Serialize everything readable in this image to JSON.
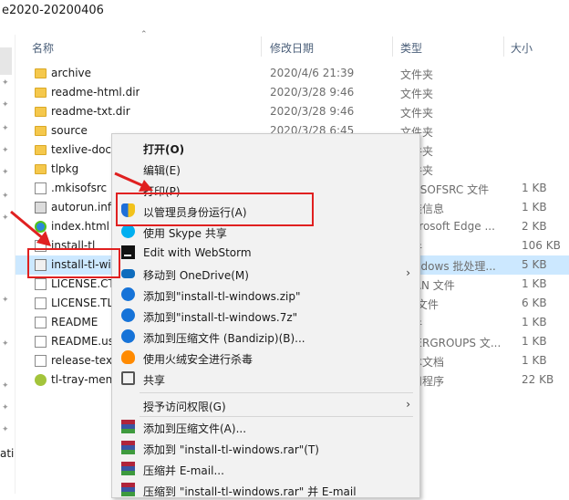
{
  "window": {
    "title": "e2020-20200406"
  },
  "nav": {
    "text": "ati"
  },
  "columns": {
    "name": "名称",
    "date": "修改日期",
    "type": "类型",
    "size": "大小"
  },
  "files": [
    {
      "name": "archive",
      "date": "2020/4/6 21:39",
      "type": "文件夹",
      "size": "",
      "icon": "folder-icon"
    },
    {
      "name": "readme-html.dir",
      "date": "2020/3/28 9:46",
      "type": "文件夹",
      "size": "",
      "icon": "folder-icon"
    },
    {
      "name": "readme-txt.dir",
      "date": "2020/3/28 9:46",
      "type": "文件夹",
      "size": "",
      "icon": "folder-icon"
    },
    {
      "name": "source",
      "date": "2020/3/28 6:45",
      "type": "文件夹",
      "size": "",
      "icon": "folder-icon"
    },
    {
      "name": "texlive-doc",
      "date": "",
      "type": "文件夹",
      "size": "",
      "icon": "folder-icon"
    },
    {
      "name": "tlpkg",
      "date": "",
      "type": "文件夹",
      "size": "",
      "icon": "folder-icon"
    },
    {
      "name": ".mkisofsrc",
      "date": "",
      "type": "MKISOFSRC 文件",
      "size": "1 KB",
      "icon": "file-icon"
    },
    {
      "name": "autorun.inf",
      "date": "",
      "type": "安装信息",
      "size": "1 KB",
      "icon": "gear-file-icon"
    },
    {
      "name": "index.html",
      "date": "",
      "type": "Microsoft Edge ...",
      "size": "2 KB",
      "icon": "edge-icon"
    },
    {
      "name": "install-tl",
      "date": "",
      "type": "文件",
      "size": "106 KB",
      "icon": "file-icon"
    },
    {
      "name": "install-tl-windows.bat",
      "date": "",
      "type": "Windows 批处理...",
      "size": "5 KB",
      "icon": "batch-file-icon"
    },
    {
      "name": "LICENSE.CTAN",
      "date": "",
      "type": "CTAN 文件",
      "size": "1 KB",
      "icon": "file-icon"
    },
    {
      "name": "LICENSE.TL",
      "date": "",
      "type": "TL 文件",
      "size": "6 KB",
      "icon": "file-icon"
    },
    {
      "name": "README",
      "date": "",
      "type": "文件",
      "size": "1 KB",
      "icon": "file-icon"
    },
    {
      "name": "README.usergroups",
      "date": "",
      "type": "USERGROUPS 文...",
      "size": "1 KB",
      "icon": "file-icon"
    },
    {
      "name": "release-texlive.txt",
      "date": "",
      "type": "文本文档",
      "size": "1 KB",
      "icon": "file-icon"
    },
    {
      "name": "tl-tray-menu.exe",
      "date": "",
      "type": "应用程序",
      "size": "22 KB",
      "icon": "tray-app-icon"
    }
  ],
  "context_menu": {
    "items": [
      {
        "label": "打开(O)",
        "icon": "",
        "bold": true
      },
      {
        "label": "编辑(E)",
        "icon": ""
      },
      {
        "label": "打印(P)",
        "icon": ""
      },
      {
        "label": "以管理员身份运行(A)",
        "icon": "shield-icon"
      },
      {
        "label": "使用 Skype 共享",
        "icon": "skype-icon"
      },
      {
        "label": "Edit with WebStorm",
        "icon": "webstorm-icon"
      },
      {
        "label": "移动到 OneDrive(M)",
        "icon": "onedrive-icon",
        "submenu": true
      },
      {
        "label": "添加到\"install-tl-windows.zip\"",
        "icon": "bandizip-icon"
      },
      {
        "label": "添加到\"install-tl-windows.7z\"",
        "icon": "bandizip-icon"
      },
      {
        "label": "添加到压缩文件 (Bandizip)(B)...",
        "icon": "bandizip-icon"
      },
      {
        "label": "使用火绒安全进行杀毒",
        "icon": "huorong-icon"
      },
      {
        "label": "共享",
        "icon": "share-icon"
      },
      {
        "label": "授予访问权限(G)",
        "icon": "",
        "submenu": true
      },
      {
        "label": "添加到压缩文件(A)...",
        "icon": "winrar-icon"
      },
      {
        "label": "添加到 \"install-tl-windows.rar\"(T)",
        "icon": "winrar-icon"
      },
      {
        "label": "压缩并 E-mail...",
        "icon": "winrar-icon"
      },
      {
        "label": "压缩到 \"install-tl-windows.rar\" 并 E-mail",
        "icon": "winrar-icon"
      }
    ],
    "submenu_glyph": "›"
  },
  "colors": {
    "selection": "#cce8ff",
    "annotation_red": "#e02020",
    "folder": "#f5c84c"
  }
}
